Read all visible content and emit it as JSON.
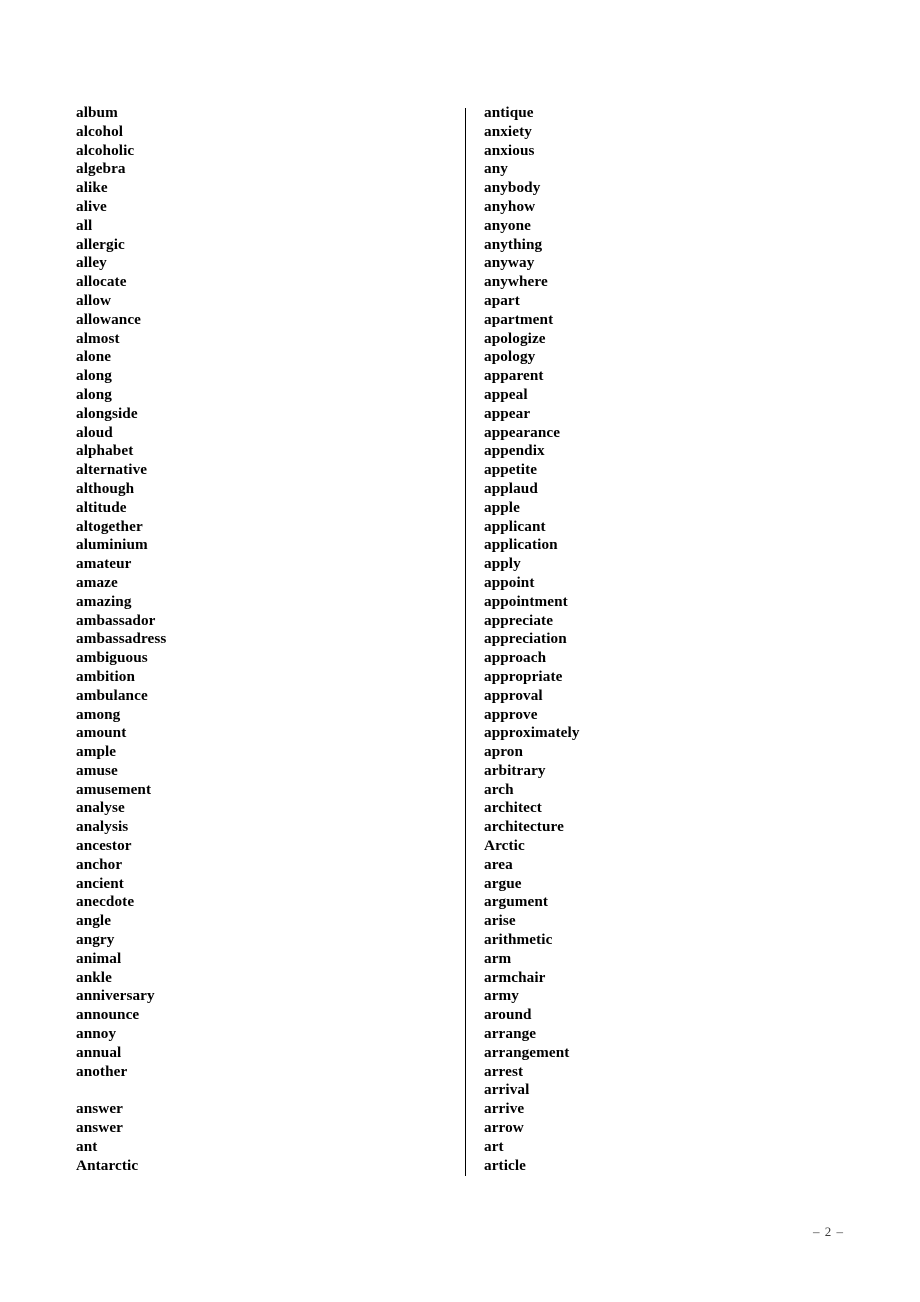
{
  "document": {
    "page_number_label": "– 2 –",
    "columns": [
      {
        "id": "left",
        "words": [
          "album",
          "alcohol",
          "alcoholic",
          "algebra",
          "alike",
          "alive",
          "all",
          "allergic",
          "alley",
          "allocate",
          "allow",
          "allowance",
          "almost",
          "alone",
          "along",
          "along",
          "alongside",
          "aloud",
          "alphabet",
          "alternative",
          "although",
          "altitude",
          "altogether",
          "aluminium",
          "amateur",
          "amaze",
          "amazing",
          "ambassador",
          "ambassadress",
          "ambiguous",
          "ambition",
          "ambulance",
          "among",
          "amount",
          "ample",
          "amuse",
          "amusement",
          "analyse",
          "analysis",
          "ancestor",
          "anchor",
          "ancient",
          "anecdote",
          "angle",
          "angry",
          "animal",
          "ankle",
          "anniversary",
          "announce",
          "annoy",
          "annual",
          "another",
          "",
          "answer",
          "answer",
          "ant",
          "Antarctic"
        ]
      },
      {
        "id": "right",
        "words": [
          "antique",
          "anxiety",
          "anxious",
          "any",
          "anybody",
          "anyhow",
          "anyone",
          "anything",
          "anyway",
          "anywhere",
          "apart",
          "apartment",
          "apologize",
          "apology",
          "apparent",
          "appeal",
          "appear",
          "appearance",
          "appendix",
          "appetite",
          "applaud",
          "apple",
          "applicant",
          "application",
          "apply",
          "appoint",
          "appointment",
          "appreciate",
          "appreciation",
          "approach",
          "appropriate",
          "approval",
          "approve",
          "approximately",
          "apron",
          "arbitrary",
          "arch",
          "architect",
          "architecture",
          "Arctic",
          "area",
          "argue",
          "argument",
          "arise",
          "arithmetic",
          "arm",
          "armchair",
          "army",
          "around",
          "arrange",
          "arrangement",
          "arrest",
          "arrival",
          "arrive",
          "arrow",
          "art",
          "article"
        ]
      }
    ]
  }
}
